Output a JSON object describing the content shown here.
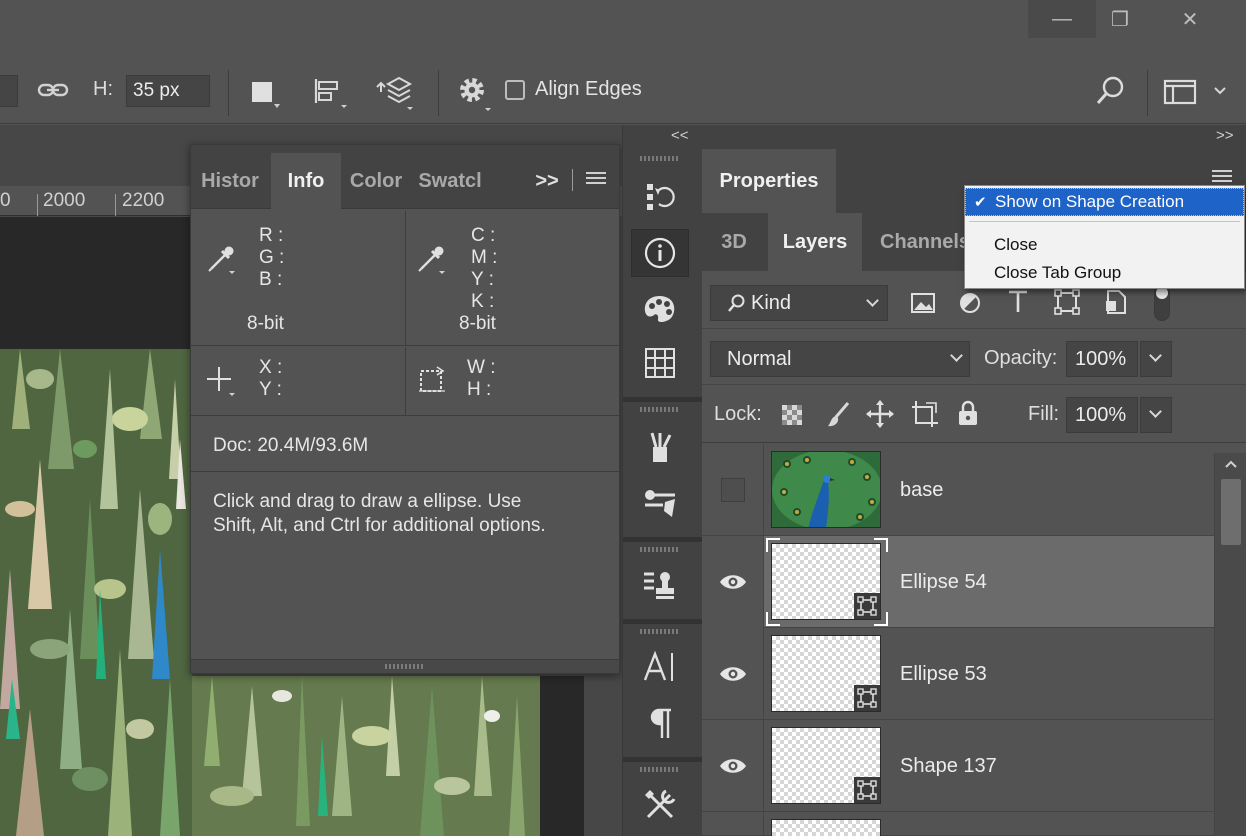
{
  "window": {
    "minimize_glyph": "—",
    "restore_glyph": "❐",
    "close_glyph": "✕"
  },
  "options_bar": {
    "height_label": "H:",
    "height_value": "35 px",
    "align_edges_label": "Align Edges",
    "align_edges_checked": false,
    "icons": [
      "link-icon",
      "path-operations-icon",
      "path-alignment-icon",
      "path-arrangement-icon",
      "gear-icon",
      "search-icon",
      "workspace-icon",
      "chevron-down-icon"
    ]
  },
  "ruler": {
    "ticks": [
      "0",
      "2000",
      "2200"
    ]
  },
  "info_panel": {
    "tabs": [
      "Histor",
      "Info",
      "Color",
      "Swatcl"
    ],
    "active_tab": "Info",
    "expand_glyph": ">>",
    "rgb_labels": [
      "R :",
      "G :",
      "B :"
    ],
    "cmyk_labels": [
      "C :",
      "M :",
      "Y :",
      "K :"
    ],
    "bit_left": "8-bit",
    "bit_right": "8-bit",
    "xy_labels": [
      "X :",
      "Y :"
    ],
    "wh_labels": [
      "W :",
      "H :"
    ],
    "doc": "Doc: 20.4M/93.6M",
    "hint_line1": "Click and drag to draw a ellipse.  Use",
    "hint_line2": "Shift, Alt, and Ctrl for additional options."
  },
  "collapse": {
    "left": "<<",
    "right": ">>"
  },
  "strip": {
    "icons": [
      "history-icon",
      "info-icon",
      "color-palette-icon",
      "swatches-grid-icon",
      "brushes-icon",
      "brush-settings-icon",
      "clone-source-icon",
      "character-icon",
      "paragraph-icon",
      "tools-icon"
    ]
  },
  "properties": {
    "title": "Properties"
  },
  "layers_panel": {
    "tabs": [
      "3D",
      "Layers",
      "Channels"
    ],
    "active_tab": "Layers",
    "filter_kind": "Kind",
    "blend_mode": "Normal",
    "opacity_label": "Opacity:",
    "opacity_value": "100%",
    "lock_label": "Lock:",
    "fill_label": "Fill:",
    "fill_value": "100%",
    "layers": [
      {
        "name": "base",
        "visible": false,
        "type": "image"
      },
      {
        "name": "Ellipse 54",
        "visible": true,
        "type": "shape",
        "selected": true
      },
      {
        "name": "Ellipse 53",
        "visible": true,
        "type": "shape"
      },
      {
        "name": "Shape 137",
        "visible": true,
        "type": "shape"
      }
    ]
  },
  "context_menu": {
    "items": [
      {
        "label": "Show on Shape Creation",
        "checked": true,
        "highlighted": true
      },
      {
        "label": "Close"
      },
      {
        "label": "Close Tab Group"
      }
    ],
    "check_glyph": "✔"
  },
  "colors": {
    "ui_bg": "#535353",
    "dark_bg": "#424242",
    "menu_highlight": "#1e63c8"
  }
}
